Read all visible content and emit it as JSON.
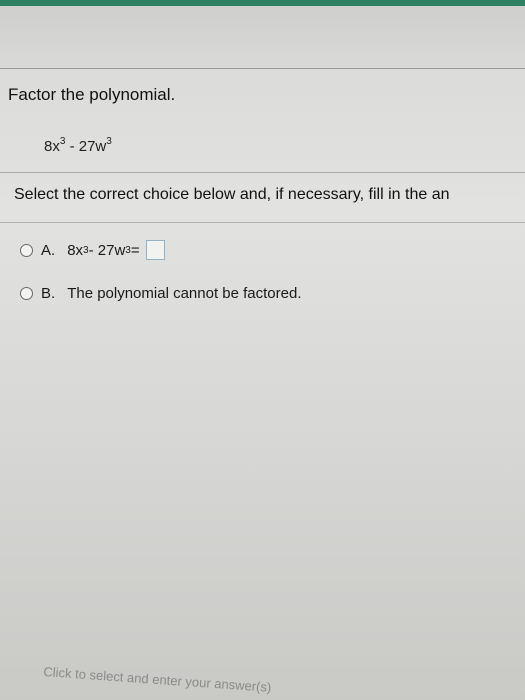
{
  "question": {
    "prompt": "Factor the polynomial.",
    "expression": {
      "t1_coef": "8x",
      "t1_exp": "3",
      "op": " - 27w",
      "t2_exp": "3"
    },
    "instruction": "Select the correct choice below and, if necessary, fill in the an"
  },
  "choices": {
    "a": {
      "letter": "A.",
      "t1_coef": "8x",
      "t1_exp": "3",
      "op": " - 27w",
      "t2_exp": "3",
      "eq": " ="
    },
    "b": {
      "letter": "B.",
      "text": "The polynomial cannot be factored."
    }
  },
  "footer": {
    "hint": "Click to select and enter your answer(s)"
  }
}
